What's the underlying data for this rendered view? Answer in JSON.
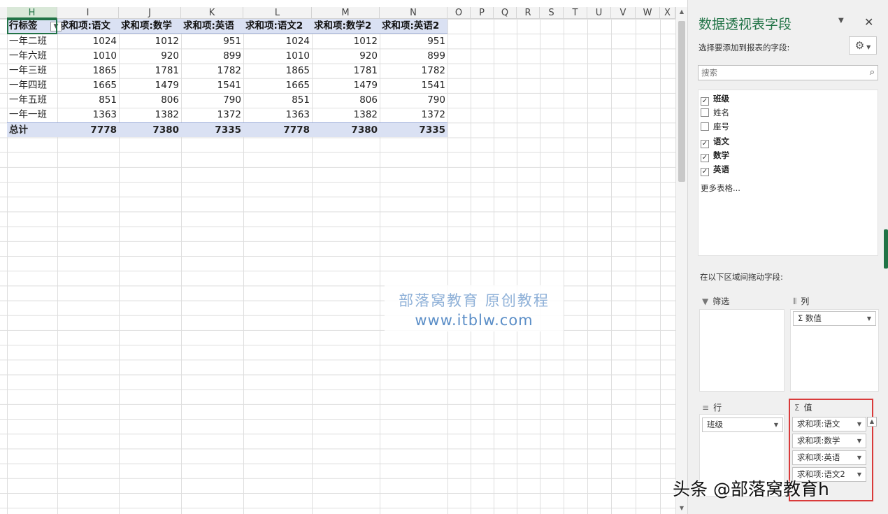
{
  "columns": [
    "H",
    "I",
    "J",
    "K",
    "L",
    "M",
    "N",
    "O",
    "P",
    "Q",
    "R",
    "S",
    "T",
    "U",
    "V",
    "W",
    "X"
  ],
  "pivot": {
    "header": [
      "行标签",
      "求和项:语文",
      "求和项:数学",
      "求和项:英语",
      "求和项:语文2",
      "求和项:数学2",
      "求和项:英语2"
    ],
    "rows": [
      [
        "一年二班",
        "1024",
        "1012",
        "951",
        "1024",
        "1012",
        "951"
      ],
      [
        "一年六班",
        "1010",
        "920",
        "899",
        "1010",
        "920",
        "899"
      ],
      [
        "一年三班",
        "1865",
        "1781",
        "1782",
        "1865",
        "1781",
        "1782"
      ],
      [
        "一年四班",
        "1665",
        "1479",
        "1541",
        "1665",
        "1479",
        "1541"
      ],
      [
        "一年五班",
        "851",
        "806",
        "790",
        "851",
        "806",
        "790"
      ],
      [
        "一年一班",
        "1363",
        "1382",
        "1372",
        "1363",
        "1382",
        "1372"
      ]
    ],
    "total": [
      "总计",
      "7778",
      "7380",
      "7335",
      "7778",
      "7380",
      "7335"
    ]
  },
  "watermark": {
    "line1": "部落窝教育   原创教程",
    "line2": "www.itblw.com"
  },
  "pane": {
    "title": "数据透视表字段",
    "subtitle": "选择要添加到报表的字段:",
    "search_placeholder": "搜索",
    "fields": [
      {
        "label": "班级",
        "checked": true
      },
      {
        "label": "姓名",
        "checked": false
      },
      {
        "label": "座号",
        "checked": false
      },
      {
        "label": "语文",
        "checked": true
      },
      {
        "label": "数学",
        "checked": true
      },
      {
        "label": "英语",
        "checked": true
      }
    ],
    "more_tables": "更多表格...",
    "drag_hint": "在以下区域间拖动字段:",
    "areas": {
      "filter": {
        "title": "筛选"
      },
      "columns": {
        "title": "列",
        "chips": [
          "Σ 数值"
        ]
      },
      "rows": {
        "title": "行",
        "chips": [
          "班级"
        ]
      },
      "values": {
        "title": "值",
        "chips": [
          "求和项:语文",
          "求和项:数学",
          "求和项:英语",
          "求和项:语文2"
        ]
      }
    }
  },
  "credit": "头条 @部落窝教育h"
}
